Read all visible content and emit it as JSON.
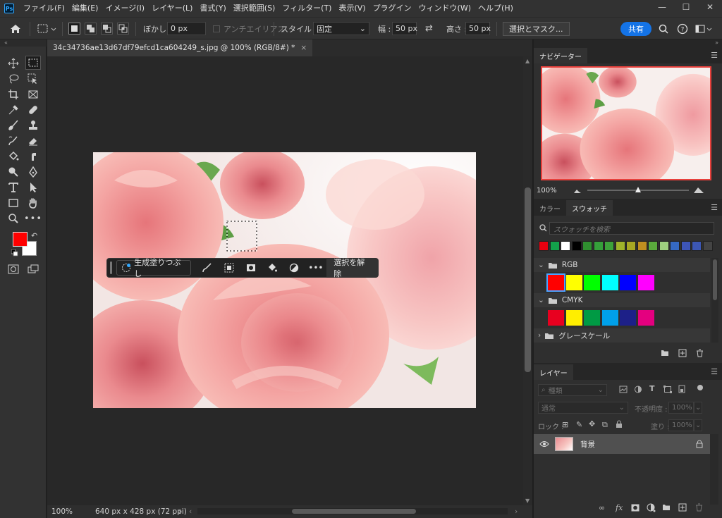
{
  "app": {
    "logo": "Ps"
  },
  "menu": [
    "ファイル(F)",
    "編集(E)",
    "イメージ(I)",
    "レイヤー(L)",
    "書式(Y)",
    "選択範囲(S)",
    "フィルター(T)",
    "表示(V)",
    "プラグイン",
    "ウィンドウ(W)",
    "ヘルプ(H)"
  ],
  "window_controls": {
    "minimize": "—",
    "maximize": "☐",
    "close": "✕"
  },
  "options": {
    "feather_label": "ぼかし :",
    "feather_value": "0 px",
    "antialias_label": "アンチエイリアス",
    "style_label": "スタイル :",
    "style_value": "固定",
    "width_label": "幅 :",
    "width_value": "50 px",
    "height_label": "高さ :",
    "height_value": "50 px",
    "select_mask": "選択とマスク...",
    "share": "共有"
  },
  "document": {
    "tab_title": "34c34736ae13d67df79efcd1ca604249_s.jpg @ 100% (RGB/8#) *",
    "zoom": "100%",
    "info": "640 px x 428 px (72 ppi)"
  },
  "taskbar": {
    "generative_fill": "生成塗りつぶし",
    "deselect": "選択を解除"
  },
  "navigator": {
    "tab": "ナビゲーター",
    "zoom": "100%",
    "zoom_fraction": 0.5
  },
  "swatches": {
    "tabs": [
      "カラー",
      "スウォッチ"
    ],
    "search_placeholder": "スウォッチを検索",
    "recent": [
      "#e8000f",
      "#13a14b",
      "#ffffff",
      "#000000",
      "#2f8f2f",
      "#35a03a",
      "#3da23a",
      "#9fb32a",
      "#a7a723",
      "#bf8f20",
      "#5aaa3c",
      "#9ecf7e",
      "#3569c2",
      "#3d55b8",
      "#3c57b5",
      "#444444"
    ],
    "groups": [
      {
        "name": "RGB",
        "colors": [
          "#ff0000",
          "#ffff00",
          "#00ff00",
          "#00ffff",
          "#0000ff",
          "#ff00ff"
        ]
      },
      {
        "name": "CMYK",
        "colors": [
          "#e8001f",
          "#ffee00",
          "#009a44",
          "#00a0e9",
          "#1d2088",
          "#e4007f"
        ]
      },
      {
        "name": "グレースケール",
        "colors": []
      }
    ]
  },
  "layers": {
    "tab": "レイヤー",
    "kind": "種類",
    "blend": "通常",
    "opacity_label": "不透明度 :",
    "opacity_value": "100%",
    "lock_label": "ロック :",
    "fill_label": "塗り :",
    "fill_value": "100%",
    "items": [
      {
        "name": "背景"
      }
    ]
  },
  "colors": {
    "foreground": "#ff0000",
    "background": "#ffffff"
  }
}
